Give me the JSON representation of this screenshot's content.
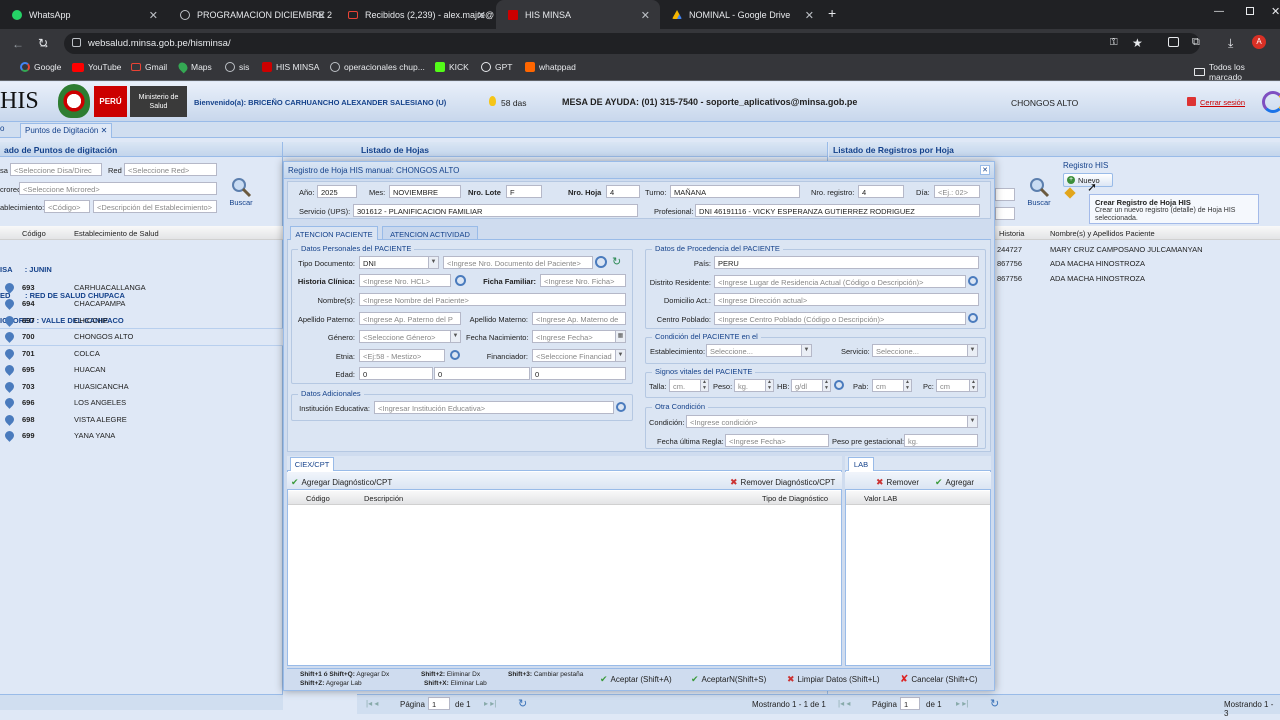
{
  "browser": {
    "tabs": [
      {
        "title": "WhatsApp"
      },
      {
        "title": "PROGRAMACION DICIEMBRE 2"
      },
      {
        "title": "Recibidos (2,239) - alex.majre@"
      },
      {
        "title": "HIS MINSA"
      },
      {
        "title": "NOMINAL - Google Drive"
      }
    ],
    "url": "websalud.minsa.gob.pe/hisminsa/",
    "bookmarks": [
      "Google",
      "YouTube",
      "Gmail",
      "Maps",
      "sis",
      "HIS MINSA",
      "operacionales chup...",
      "KICK",
      "GPT",
      "whatppad"
    ],
    "other_bookmarks": "Todos los marcado",
    "profile_initial": "A"
  },
  "header": {
    "logo": "HIS",
    "peru": "PERÚ",
    "ministry": "Ministerio de Salud",
    "welcome": "Bienvenido(a): BRICEÑO CARHUANCHO ALEXANDER SALESIANO (U)",
    "days": "58 das",
    "help": "MESA DE AYUDA: (01) 315-7540 - soporte_aplicativos@minsa.gob.pe",
    "establishment": "CHONGOS ALTO",
    "logout": "Cerrar sesión"
  },
  "tab_strip": {
    "left_stub": "o",
    "tab": "Puntos de Digitación"
  },
  "left_panel": {
    "title": "ado de Puntos de digitación",
    "disa_label": "sa",
    "disa_ph": "<Seleccione Disa/Direc",
    "red_label": "Red",
    "red_ph": "<Seleccione Red>",
    "microred_label": "crored",
    "microred_ph": "<Seleccione Microred>",
    "est_label": "ablecimiento:",
    "est_code_ph": "<Código>",
    "est_desc_ph": "<Descripción del Establecimiento>",
    "search": "Buscar",
    "col_code": "Código",
    "col_name": "Establecimiento de Salud",
    "group": [
      "ISA      : JUNIN",
      "ED       : RED DE SALUD CHUPACA",
      "ICRORED : VALLE DEL CANIPACO"
    ],
    "rows": [
      {
        "code": "693",
        "name": "CARHUACALLANGA"
      },
      {
        "code": "694",
        "name": "CHACAPAMPA"
      },
      {
        "code": "697",
        "name": "CHICCHE"
      },
      {
        "code": "700",
        "name": "CHONGOS ALTO"
      },
      {
        "code": "701",
        "name": "COLCA"
      },
      {
        "code": "695",
        "name": "HUACAN"
      },
      {
        "code": "703",
        "name": "HUASICANCHA"
      },
      {
        "code": "696",
        "name": "LOS ANGELES"
      },
      {
        "code": "698",
        "name": "VISTA ALEGRE"
      },
      {
        "code": "699",
        "name": "YANA YANA"
      }
    ]
  },
  "middle_panel": {
    "title": "Listado de Hojas",
    "page_label": "Página",
    "page": "1",
    "of": "de 1",
    "showing": "Mostrando 1 - 1 de 1"
  },
  "right_panel": {
    "title": "Listado de Registros por Hoja",
    "registro_his": "Registro HIS",
    "new_btn": "Nuevo",
    "search": "Buscar",
    "col_hist": "Historia",
    "col_name": "Nombre(s) y Apellidos Paciente",
    "rows": [
      {
        "hist": "244727",
        "name": "MARY CRUZ CAMPOSANO JULCAMANYAN"
      },
      {
        "hist": "867756",
        "name": "ADA MACHA HINOSTROZA"
      },
      {
        "hist": "867756",
        "name": "ADA MACHA HINOSTROZA"
      }
    ],
    "page_label": "Página",
    "page": "1",
    "of": "de 1",
    "showing": "Mostrando 1 - 3",
    "tooltip_title": "Crear Registro de Hoja HIS",
    "tooltip_body": "Crear un nuevo registro (detalle) de Hoja HIS seleccionada."
  },
  "modal": {
    "title": "Registro de Hoja HIS manual: CHONGOS ALTO",
    "anio_l": "Año:",
    "anio": "2025",
    "mes_l": "Mes:",
    "mes": "NOVIEMBRE",
    "lote_l": "Nro. Lote",
    "lote": "F",
    "hoja_l": "Nro. Hoja",
    "hoja": "4",
    "turno_l": "Turno:",
    "turno": "MAÑANA",
    "nreg_l": "Nro. registro:",
    "nreg": "4",
    "dia_l": "Día:",
    "dia_ph": "<Ej.: 02>",
    "servicio_l": "Servicio (UPS):",
    "servicio": "301612 - PLANIFICACION FAMILIAR",
    "prof_l": "Profesional:",
    "prof": "DNI 46191116 - VICKY ESPERANZA GUTIERREZ RODRIGUEZ",
    "tabs": [
      "ATENCION PACIENTE",
      "ATENCION ACTIVIDAD"
    ],
    "personal": {
      "legend": "Datos Personales del PACIENTE",
      "tipo_doc_l": "Tipo Documento:",
      "tipo_doc": "DNI",
      "nro_doc_ph": "<Ingrese Nro. Documento del Paciente>",
      "hcl_l": "Historia Clínica:",
      "hcl_ph": "<Ingrese Nro. HCL>",
      "ficha_l": "Ficha Familiar:",
      "ficha_ph": "<Ingrese Nro. Ficha>",
      "nombres_l": "Nombre(s):",
      "nombres_ph": "<Ingrese Nombre del Paciente>",
      "ap_pat_l": "Apellido Paterno:",
      "ap_pat_ph": "<Ingrese Ap. Paterno del P",
      "ap_mat_l": "Apellido Materno:",
      "ap_mat_ph": "<Ingrese Ap. Materno de",
      "genero_l": "Género:",
      "genero_ph": "<Seleccione Género>",
      "fnac_l": "Fecha Nacimiento:",
      "fnac_ph": "<Ingrese Fecha>",
      "etnia_l": "Etnia:",
      "etnia_ph": "<Ej:58 - Mestizo>",
      "financ_l": "Financiador:",
      "financ_ph": "<Seleccione Financiad",
      "edad_l": "Edad:",
      "edad": [
        "0",
        "0",
        "0"
      ]
    },
    "adicionales": {
      "legend": "Datos Adicionales",
      "inst_l": "Institución Educativa:",
      "inst_ph": "<Ingresar Institución Educativa>"
    },
    "procedencia": {
      "legend": "Datos de Procedencia del PACIENTE",
      "pais_l": "País:",
      "pais": "PERU",
      "distrito_l": "Distrito Residente:",
      "distrito_ph": "<Ingrese Lugar de Residencia Actual (Código o Descripción)>",
      "domicilio_l": "Domicilio Act.:",
      "domicilio_ph": "<Ingrese Dirección actual>",
      "centro_l": "Centro Poblado:",
      "centro_ph": "<Ingrese Centro Poblado (Código o Descripción)>"
    },
    "condicion": {
      "legend": "Condición del PACIENTE en el",
      "est_l": "Establecimiento:",
      "est_ph": "Seleccione...",
      "serv_l": "Servicio:",
      "serv_ph": "Seleccione..."
    },
    "signos": {
      "legend": "Signos vitales del PACIENTE",
      "talla_l": "Talla:",
      "talla_ph": "cm.",
      "peso_l": "Peso:",
      "peso_ph": "kg.",
      "hb_l": "HB:",
      "hb_ph": "g/dl",
      "pab_l": "Pab:",
      "pab_ph": "cm",
      "pc_l": "Pc:",
      "pc_ph": "cm"
    },
    "otra": {
      "legend": "Otra Condición",
      "cond_l": "Condición:",
      "cond_ph": "<Ingrese condición>",
      "regla_l": "Fecha última Regla:",
      "regla_ph": "<Ingrese Fecha>",
      "peso_ges_l": "Peso pre gestacional:",
      "peso_ges_ph": "kg."
    },
    "ciex": {
      "tab": "CIEX/CPT",
      "add": "Agregar Diagnóstico/CPT",
      "remove": "Remover Diagnóstico/CPT",
      "col_code": "Código",
      "col_desc": "Descripción",
      "col_tipo": "Tipo de Diagnóstico"
    },
    "lab": {
      "tab": "LAB",
      "remove": "Remover",
      "add": "Agregar",
      "col_val": "Valor LAB"
    },
    "shortcuts": [
      {
        "k": "Shift+1 ó Shift+Q:",
        "v": "Agregar Dx"
      },
      {
        "k": "Shift+Z:",
        "v": "Agregar Lab"
      },
      {
        "k": "Shift+2:",
        "v": "Eliminar Dx"
      },
      {
        "k": "Shift+X:",
        "v": "Eliminar Lab"
      },
      {
        "k": "Shift+3:",
        "v": "Cambiar pestaña"
      }
    ],
    "buttons": {
      "accept": "Aceptar (Shift+A)",
      "accept_n": "AceptarN(Shift+S)",
      "clear": "Limpiar Datos (Shift+L)",
      "cancel": "Cancelar (Shift+C)"
    }
  },
  "colors": {
    "accent": "#15428b",
    "panel": "#dfe8f6",
    "chrome": "#202124",
    "red": "#c00000"
  }
}
